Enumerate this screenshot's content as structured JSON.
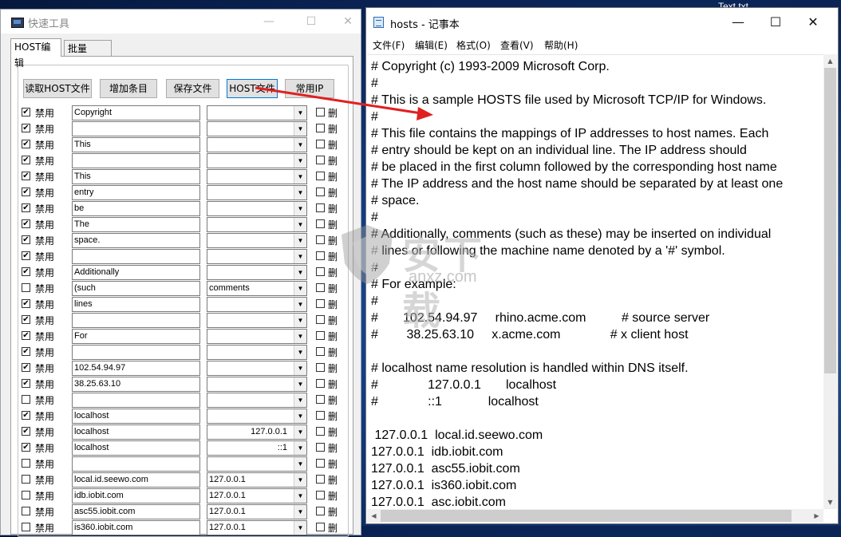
{
  "desktop": {
    "file_label": "Text.txt"
  },
  "tool": {
    "title": "快速工具",
    "controls": {
      "min": "—",
      "max": "☐",
      "close": "✕"
    },
    "tabs": [
      {
        "label": "HOST编辑"
      },
      {
        "label": "批量PING"
      }
    ],
    "buttons": {
      "read": "读取HOST文件",
      "add": "增加条目",
      "save": "保存文件",
      "hostfile": "HOST文件",
      "common_ip": "常用IP"
    },
    "disable_label": "禁用",
    "delete_label": "删",
    "dropdown_glyph": "▼",
    "rows": [
      {
        "checked": true,
        "host": "Copyright",
        "ip": "",
        "ip_align": "left"
      },
      {
        "checked": true,
        "host": "",
        "ip": "",
        "ip_align": "left"
      },
      {
        "checked": true,
        "host": "This",
        "ip": "",
        "ip_align": "left"
      },
      {
        "checked": true,
        "host": "",
        "ip": "",
        "ip_align": "left"
      },
      {
        "checked": true,
        "host": "This",
        "ip": "",
        "ip_align": "left"
      },
      {
        "checked": true,
        "host": "entry",
        "ip": "",
        "ip_align": "left"
      },
      {
        "checked": true,
        "host": "be",
        "ip": "",
        "ip_align": "left"
      },
      {
        "checked": true,
        "host": "The",
        "ip": "",
        "ip_align": "left"
      },
      {
        "checked": true,
        "host": "space.",
        "ip": "",
        "ip_align": "left"
      },
      {
        "checked": true,
        "host": "",
        "ip": "",
        "ip_align": "left"
      },
      {
        "checked": true,
        "host": "Additionally",
        "ip": "",
        "ip_align": "left"
      },
      {
        "checked": false,
        "host": "(such",
        "ip": "comments",
        "ip_align": "left"
      },
      {
        "checked": true,
        "host": "lines",
        "ip": "",
        "ip_align": "left"
      },
      {
        "checked": true,
        "host": "",
        "ip": "",
        "ip_align": "left"
      },
      {
        "checked": true,
        "host": "For",
        "ip": "",
        "ip_align": "left"
      },
      {
        "checked": true,
        "host": "",
        "ip": "",
        "ip_align": "left"
      },
      {
        "checked": true,
        "host": "102.54.94.97",
        "ip": "",
        "ip_align": "left"
      },
      {
        "checked": true,
        "host": "38.25.63.10",
        "ip": "",
        "ip_align": "left"
      },
      {
        "checked": false,
        "host": "",
        "ip": "",
        "ip_align": "left"
      },
      {
        "checked": true,
        "host": "localhost",
        "ip": "",
        "ip_align": "left"
      },
      {
        "checked": true,
        "host": "localhost",
        "ip": "127.0.0.1",
        "ip_align": "right"
      },
      {
        "checked": true,
        "host": "localhost",
        "ip": "::1",
        "ip_align": "right"
      },
      {
        "checked": false,
        "host": "",
        "ip": "",
        "ip_align": "left"
      },
      {
        "checked": false,
        "host": "local.id.seewo.com",
        "ip": "127.0.0.1",
        "ip_align": "left"
      },
      {
        "checked": false,
        "host": "idb.iobit.com",
        "ip": "127.0.0.1",
        "ip_align": "left"
      },
      {
        "checked": false,
        "host": "asc55.iobit.com",
        "ip": "127.0.0.1",
        "ip_align": "left"
      },
      {
        "checked": false,
        "host": "is360.iobit.com",
        "ip": "127.0.0.1",
        "ip_align": "left"
      }
    ]
  },
  "notepad": {
    "title": "hosts - 记事本",
    "controls": {
      "min": "—",
      "max": "☐",
      "close": "✕"
    },
    "menu": [
      "文件(F)",
      "编辑(E)",
      "格式(O)",
      "查看(V)",
      "帮助(H)"
    ],
    "lines": [
      "# Copyright (c) 1993-2009 Microsoft Corp.",
      "#",
      "# This is a sample HOSTS file used by Microsoft TCP/IP for Windows.",
      "#",
      "# This file contains the mappings of IP addresses to host names. Each",
      "# entry should be kept on an individual line. The IP address should",
      "# be placed in the first column followed by the corresponding host name",
      "# The IP address and the host name should be separated by at least one",
      "# space.",
      "#",
      "# Additionally, comments (such as these) may be inserted on individual",
      "# lines or following the machine name denoted by a '#' symbol.",
      "#",
      "# For example:",
      "#",
      "#       102.54.94.97     rhino.acme.com          # source server",
      "#        38.25.63.10     x.acme.com              # x client host",
      "",
      "# localhost name resolution is handled within DNS itself.",
      "#              127.0.0.1       localhost",
      "#              ::1             localhost",
      "",
      " 127.0.0.1  local.id.seewo.com",
      "127.0.0.1  idb.iobit.com",
      "127.0.0.1  asc55.iobit.com",
      "127.0.0.1  is360.iobit.com",
      "127.0.0.1  asc.iobit.com"
    ]
  },
  "watermark": {
    "text": "安下载",
    "sub": "anxz.com"
  },
  "colors": {
    "arrow": "#e02020",
    "focus_border": "#0078d7"
  }
}
